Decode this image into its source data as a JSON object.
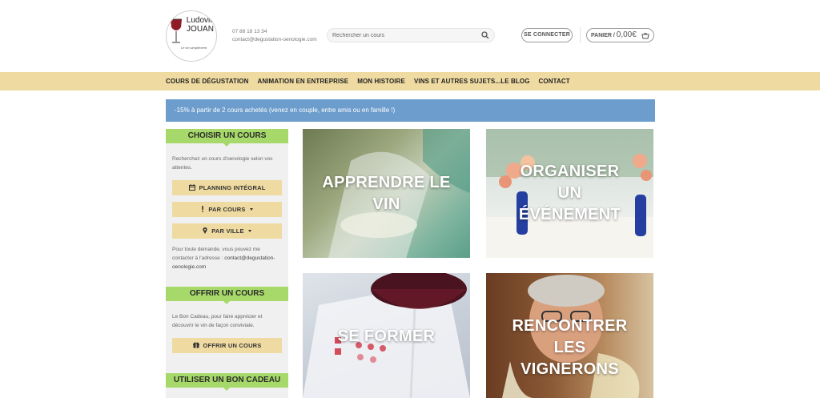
{
  "header": {
    "logo": {
      "name_line1": "Ludovic",
      "name_line2": "JOUAN",
      "tagline": "Le vin simplement"
    },
    "phone": "07 88 18 13 34",
    "email": "contact@degustation-oenologie.com",
    "search": {
      "placeholder": "Rechercher un cours",
      "icon": "search-icon"
    },
    "login_label": "SE CONNECTER",
    "cart": {
      "label": "PANIER /",
      "amount": "0,00€",
      "icon": "basket-icon"
    }
  },
  "nav": {
    "items": [
      {
        "label": "COURS DE DÉGUSTATION"
      },
      {
        "label": "ANIMATION EN ENTREPRISE"
      },
      {
        "label": "MON HISTOIRE"
      },
      {
        "label": "VINS ET AUTRES SUJETS...LE BLOG"
      },
      {
        "label": "CONTACT"
      }
    ]
  },
  "promo": {
    "text": "-15% à partir de 2 cours achetés (venez en couple, entre amis ou en famille !)"
  },
  "sidebar": {
    "choose": {
      "title": "CHOISIR UN COURS",
      "intro": "Recherchez un cours d'oenologie selon vos attentes.",
      "buttons": [
        {
          "label": "PLANNING INTÉGRAL",
          "icon": "calendar-icon"
        },
        {
          "label": "PAR COURS",
          "icon": "exclamation-icon"
        },
        {
          "label": "PAR VILLE",
          "icon": "map-pin-icon"
        }
      ],
      "contact_text": "Pour toute demande, vous pouvez me contacter à l'adresse : ",
      "contact_link": "contact@degustation-oenologie.com"
    },
    "offer": {
      "title": "OFFRIR UN COURS",
      "text": "Le Bon Cadeau, pour faire apprécier et découvrir le vin de façon conviviale.",
      "button": {
        "label": "OFFRIR UN COURS",
        "icon": "gift-icon"
      }
    },
    "voucher": {
      "title": "UTILISER UN BON CADEAU"
    }
  },
  "tiles": [
    {
      "line1": "APPRENDRE LE",
      "line2": "VIN",
      "line3": ""
    },
    {
      "line1": "ORGANISER",
      "line2": "UN",
      "line3": "ÉVÉNEMENT"
    },
    {
      "line1": "SE FORMER",
      "line2": "",
      "line3": ""
    },
    {
      "line1": "RENCONTRER",
      "line2": "LES",
      "line3": "VIGNERONS"
    }
  ],
  "colors": {
    "nav_bg": "#efdba1",
    "promo_bg": "#6d9dcc",
    "sidebar_head": "#a6d96a",
    "sidebar_bg": "#f0f0f0"
  }
}
